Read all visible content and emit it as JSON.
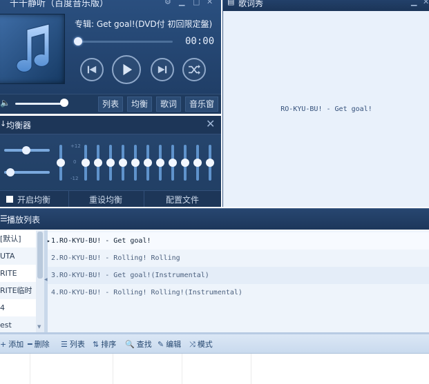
{
  "player": {
    "app_title": "千千静听（百度音乐版）",
    "album_line": "专辑: Get goal!(DVD付 初回限定盤)",
    "time": "00:00",
    "progress": 0,
    "volume": 0.85,
    "buttons": [
      "列表",
      "均衡",
      "歌词",
      "音乐窗"
    ]
  },
  "equalizer": {
    "title": "均衡器",
    "scale": [
      "+12",
      "0",
      "-12"
    ],
    "preamp_levels": [
      0.4,
      0.05
    ],
    "band_levels": [
      0.5,
      0.5,
      0.5,
      0.5,
      0.5,
      0.5,
      0.5,
      0.5,
      0.5,
      0.5,
      0.5,
      0.5
    ],
    "footer": {
      "enable": "开启均衡",
      "reset": "重设均衡",
      "config": "配置文件"
    }
  },
  "lyrics": {
    "title": "歌词秀",
    "current_line": "RO-KYU-BU! - Get goal!"
  },
  "playlist": {
    "title": "播放列表",
    "sidebar": [
      "[默认]",
      "UTA",
      "RITE",
      "RITE临时",
      "4",
      "est"
    ],
    "tracks": [
      "1.RO-KYU-BU! - Get goal!",
      "2.RO-KYU-BU! - Rolling! Rolling",
      "3.RO-KYU-BU! - Get goal!(Instrumental)",
      "4.RO-KYU-BU! - Rolling! Rolling!(Instrumental)"
    ]
  },
  "toolbar": {
    "items": [
      {
        "icon": "+",
        "label": "添加"
      },
      {
        "icon": "━",
        "label": "删除"
      },
      {
        "icon": "☰",
        "label": "列表"
      },
      {
        "icon": "⇅",
        "label": "排序"
      },
      {
        "icon": "🔍",
        "label": "查找"
      },
      {
        "icon": "✎",
        "label": "编辑"
      },
      {
        "icon": "⤨",
        "label": "模式"
      }
    ]
  },
  "colors": {
    "panel_dark": "#1d3658",
    "panel_mid": "#27466f",
    "lyrics_bg": "#e9f1fb",
    "accent": "#7aa9de"
  }
}
